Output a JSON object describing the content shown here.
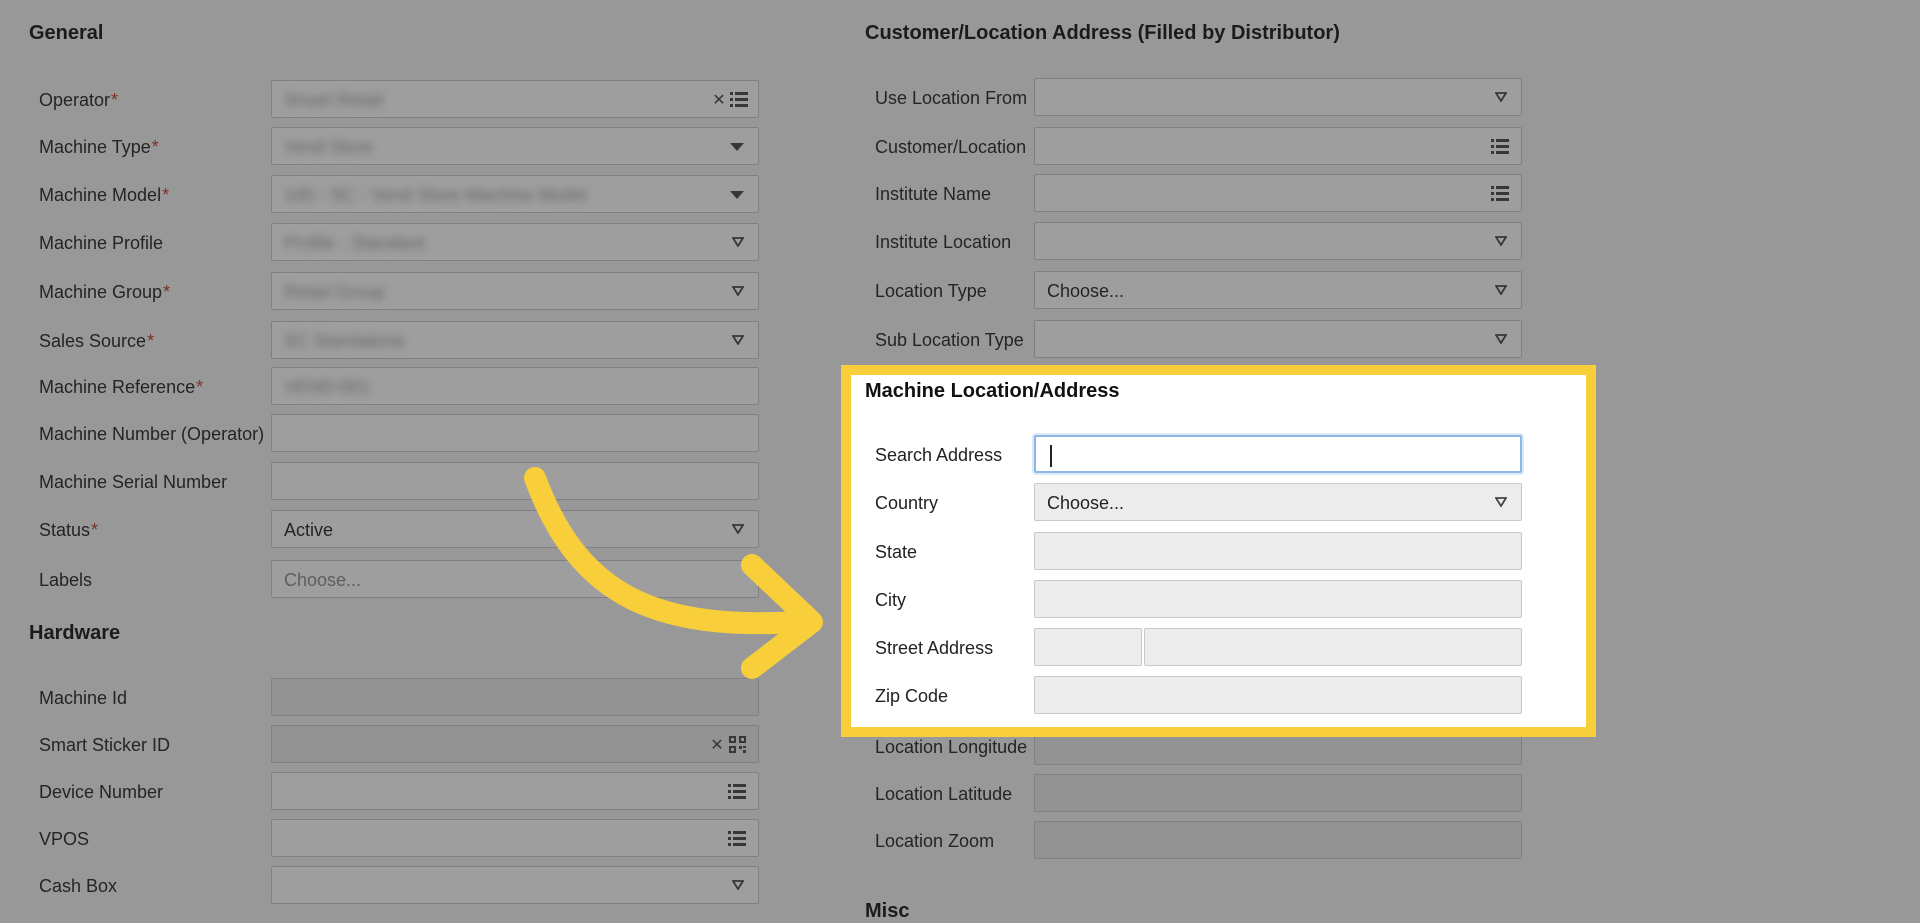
{
  "general": {
    "title": "General",
    "fields": [
      {
        "label": "Operator",
        "required": true,
        "value": "Smart Retail",
        "blurred": true
      },
      {
        "label": "Machine Type",
        "required": true,
        "value": "Vend Store",
        "blurred": true
      },
      {
        "label": "Machine Model",
        "required": true,
        "value": "100 - SC - Vend Store Machine Model",
        "blurred": true
      },
      {
        "label": "Machine Profile",
        "required": false,
        "value": "Profile - Standard",
        "blurred": true
      },
      {
        "label": "Machine Group",
        "required": true,
        "value": "Retail Group",
        "blurred": true
      },
      {
        "label": "Sales Source",
        "required": true,
        "value": "SC Standalone",
        "blurred": true
      },
      {
        "label": "Machine Reference",
        "required": true,
        "value": "VEND-001",
        "blurred": true
      },
      {
        "label": "Machine Number (Operator)",
        "required": false,
        "value": ""
      },
      {
        "label": "Machine Serial Number",
        "required": false,
        "value": ""
      },
      {
        "label": "Status",
        "required": true,
        "value": "Active"
      },
      {
        "label": "Labels",
        "required": false,
        "placeholder": "Choose..."
      }
    ]
  },
  "hardware": {
    "title": "Hardware",
    "fields": [
      {
        "label": "Machine Id",
        "value": ""
      },
      {
        "label": "Smart Sticker ID",
        "value": ""
      },
      {
        "label": "Device Number",
        "value": ""
      },
      {
        "label": "VPOS",
        "value": ""
      },
      {
        "label": "Cash Box",
        "value": ""
      }
    ]
  },
  "customer": {
    "title": "Customer/Location Address (Filled by Distributor)",
    "fields": [
      {
        "label": "Use Location From",
        "value": ""
      },
      {
        "label": "Customer/Location",
        "value": ""
      },
      {
        "label": "Institute Name",
        "value": ""
      },
      {
        "label": "Institute Location",
        "value": ""
      },
      {
        "label": "Location Type",
        "value": "Choose..."
      },
      {
        "label": "Sub Location Type",
        "value": ""
      }
    ]
  },
  "machine_location": {
    "title": "Machine Location/Address",
    "fields": [
      {
        "label": "Search Address",
        "value": ""
      },
      {
        "label": "Country",
        "value": "Choose..."
      },
      {
        "label": "State",
        "value": ""
      },
      {
        "label": "City",
        "value": ""
      },
      {
        "label": "Street Address",
        "value": ""
      },
      {
        "label": "Zip Code",
        "value": ""
      }
    ]
  },
  "location_extra": {
    "fields": [
      {
        "label": "Location Longitude",
        "value": ""
      },
      {
        "label": "Location Latitude",
        "value": ""
      },
      {
        "label": "Location Zoom",
        "value": ""
      }
    ]
  },
  "misc": {
    "title": "Misc"
  },
  "colors": {
    "highlight": "#f8cf3b",
    "required": "#c0392b",
    "focus": "#8fb7e6"
  },
  "icons": [
    "clear-icon",
    "list-icon",
    "dropdown-arrow-icon",
    "qr-code-icon",
    "curved-arrow-icon"
  ]
}
